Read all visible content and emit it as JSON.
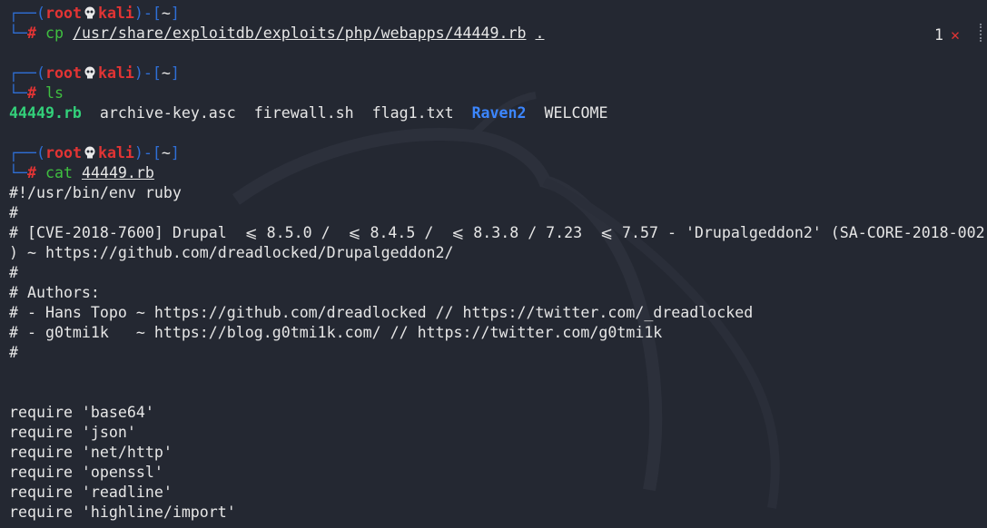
{
  "prompt": {
    "user": "root",
    "host": "kali",
    "dir": "~",
    "open": "(",
    "close": ")",
    "dash": "-",
    "lbr": "[",
    "rbr": "]",
    "hash": "#",
    "top_corner": "┌──",
    "bot_corner": "└─"
  },
  "commands": [
    {
      "name": "cp",
      "arg1": "/usr/share/exploitdb/exploits/php/webapps/44449.rb",
      "arg2": "."
    },
    {
      "name": "ls"
    },
    {
      "name": "cat",
      "arg1": "44449.rb"
    }
  ],
  "status": {
    "count": "1",
    "error_mark": "✕"
  },
  "ls_output": [
    "44449.rb",
    "archive-key.asc",
    "firewall.sh",
    "flag1.txt",
    "Raven2",
    "WELCOME"
  ],
  "file_lines": [
    "#!/usr/bin/env ruby",
    "#",
    "# [CVE-2018-7600] Drupal  ⩽ 8.5.0 /  ⩽ 8.4.5 /  ⩽ 8.3.8 / 7.23  ⩽ 7.57 - 'Drupalgeddon2' (SA-CORE-2018-002",
    ") ~ https://github.com/dreadlocked/Drupalgeddon2/",
    "#",
    "# Authors:",
    "# - Hans Topo ~ https://github.com/dreadlocked // https://twitter.com/_dreadlocked",
    "# - g0tmi1k   ~ https://blog.g0tmi1k.com/ // https://twitter.com/g0tmi1k",
    "#",
    "",
    "",
    "require 'base64'",
    "require 'json'",
    "require 'net/http'",
    "require 'openssl'",
    "require 'readline'",
    "require 'highline/import'"
  ],
  "colors": {
    "background": "#242832",
    "prompt_frame": "#2f6fd6",
    "user_host": "#e23434",
    "command": "#3fbf40",
    "rb_file": "#33d07a",
    "directory": "#3c86ff"
  }
}
